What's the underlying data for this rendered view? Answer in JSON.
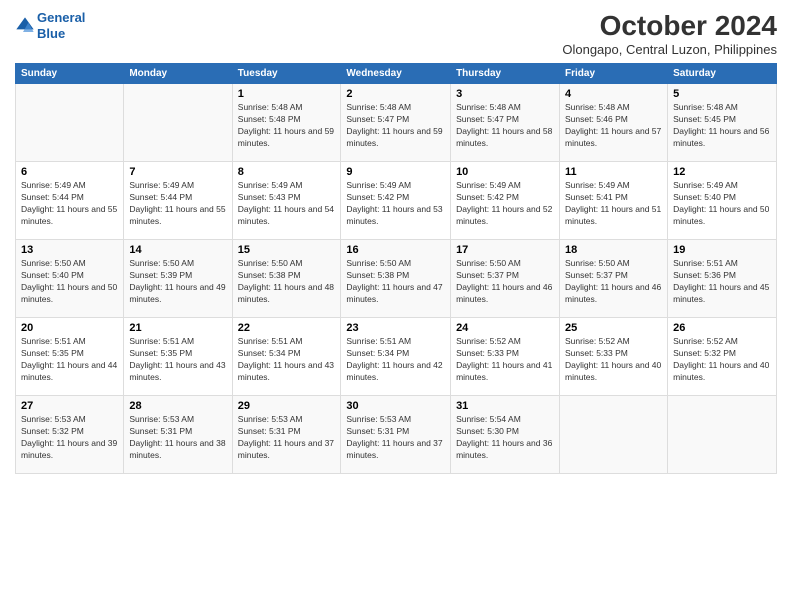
{
  "logo": {
    "line1": "General",
    "line2": "Blue"
  },
  "title": "October 2024",
  "subtitle": "Olongapo, Central Luzon, Philippines",
  "headers": [
    "Sunday",
    "Monday",
    "Tuesday",
    "Wednesday",
    "Thursday",
    "Friday",
    "Saturday"
  ],
  "weeks": [
    [
      {
        "day": "",
        "info": ""
      },
      {
        "day": "",
        "info": ""
      },
      {
        "day": "1",
        "info": "Sunrise: 5:48 AM\nSunset: 5:48 PM\nDaylight: 11 hours and 59 minutes."
      },
      {
        "day": "2",
        "info": "Sunrise: 5:48 AM\nSunset: 5:47 PM\nDaylight: 11 hours and 59 minutes."
      },
      {
        "day": "3",
        "info": "Sunrise: 5:48 AM\nSunset: 5:47 PM\nDaylight: 11 hours and 58 minutes."
      },
      {
        "day": "4",
        "info": "Sunrise: 5:48 AM\nSunset: 5:46 PM\nDaylight: 11 hours and 57 minutes."
      },
      {
        "day": "5",
        "info": "Sunrise: 5:48 AM\nSunset: 5:45 PM\nDaylight: 11 hours and 56 minutes."
      }
    ],
    [
      {
        "day": "6",
        "info": "Sunrise: 5:49 AM\nSunset: 5:44 PM\nDaylight: 11 hours and 55 minutes."
      },
      {
        "day": "7",
        "info": "Sunrise: 5:49 AM\nSunset: 5:44 PM\nDaylight: 11 hours and 55 minutes."
      },
      {
        "day": "8",
        "info": "Sunrise: 5:49 AM\nSunset: 5:43 PM\nDaylight: 11 hours and 54 minutes."
      },
      {
        "day": "9",
        "info": "Sunrise: 5:49 AM\nSunset: 5:42 PM\nDaylight: 11 hours and 53 minutes."
      },
      {
        "day": "10",
        "info": "Sunrise: 5:49 AM\nSunset: 5:42 PM\nDaylight: 11 hours and 52 minutes."
      },
      {
        "day": "11",
        "info": "Sunrise: 5:49 AM\nSunset: 5:41 PM\nDaylight: 11 hours and 51 minutes."
      },
      {
        "day": "12",
        "info": "Sunrise: 5:49 AM\nSunset: 5:40 PM\nDaylight: 11 hours and 50 minutes."
      }
    ],
    [
      {
        "day": "13",
        "info": "Sunrise: 5:50 AM\nSunset: 5:40 PM\nDaylight: 11 hours and 50 minutes."
      },
      {
        "day": "14",
        "info": "Sunrise: 5:50 AM\nSunset: 5:39 PM\nDaylight: 11 hours and 49 minutes."
      },
      {
        "day": "15",
        "info": "Sunrise: 5:50 AM\nSunset: 5:38 PM\nDaylight: 11 hours and 48 minutes."
      },
      {
        "day": "16",
        "info": "Sunrise: 5:50 AM\nSunset: 5:38 PM\nDaylight: 11 hours and 47 minutes."
      },
      {
        "day": "17",
        "info": "Sunrise: 5:50 AM\nSunset: 5:37 PM\nDaylight: 11 hours and 46 minutes."
      },
      {
        "day": "18",
        "info": "Sunrise: 5:50 AM\nSunset: 5:37 PM\nDaylight: 11 hours and 46 minutes."
      },
      {
        "day": "19",
        "info": "Sunrise: 5:51 AM\nSunset: 5:36 PM\nDaylight: 11 hours and 45 minutes."
      }
    ],
    [
      {
        "day": "20",
        "info": "Sunrise: 5:51 AM\nSunset: 5:35 PM\nDaylight: 11 hours and 44 minutes."
      },
      {
        "day": "21",
        "info": "Sunrise: 5:51 AM\nSunset: 5:35 PM\nDaylight: 11 hours and 43 minutes."
      },
      {
        "day": "22",
        "info": "Sunrise: 5:51 AM\nSunset: 5:34 PM\nDaylight: 11 hours and 43 minutes."
      },
      {
        "day": "23",
        "info": "Sunrise: 5:51 AM\nSunset: 5:34 PM\nDaylight: 11 hours and 42 minutes."
      },
      {
        "day": "24",
        "info": "Sunrise: 5:52 AM\nSunset: 5:33 PM\nDaylight: 11 hours and 41 minutes."
      },
      {
        "day": "25",
        "info": "Sunrise: 5:52 AM\nSunset: 5:33 PM\nDaylight: 11 hours and 40 minutes."
      },
      {
        "day": "26",
        "info": "Sunrise: 5:52 AM\nSunset: 5:32 PM\nDaylight: 11 hours and 40 minutes."
      }
    ],
    [
      {
        "day": "27",
        "info": "Sunrise: 5:53 AM\nSunset: 5:32 PM\nDaylight: 11 hours and 39 minutes."
      },
      {
        "day": "28",
        "info": "Sunrise: 5:53 AM\nSunset: 5:31 PM\nDaylight: 11 hours and 38 minutes."
      },
      {
        "day": "29",
        "info": "Sunrise: 5:53 AM\nSunset: 5:31 PM\nDaylight: 11 hours and 37 minutes."
      },
      {
        "day": "30",
        "info": "Sunrise: 5:53 AM\nSunset: 5:31 PM\nDaylight: 11 hours and 37 minutes."
      },
      {
        "day": "31",
        "info": "Sunrise: 5:54 AM\nSunset: 5:30 PM\nDaylight: 11 hours and 36 minutes."
      },
      {
        "day": "",
        "info": ""
      },
      {
        "day": "",
        "info": ""
      }
    ]
  ]
}
